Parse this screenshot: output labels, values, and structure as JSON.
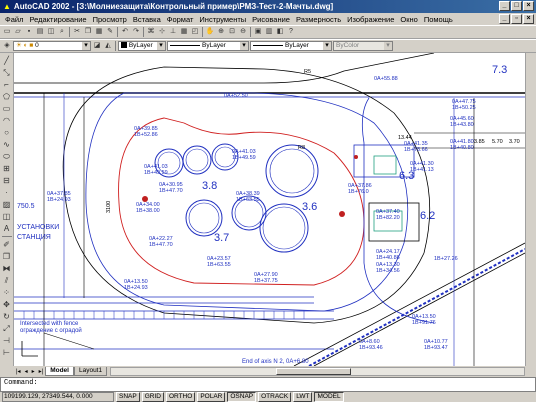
{
  "window": {
    "title": "AutoCAD 2002 - [З:\\Молниезащита\\Контрольный пример\\РМЗ-Тест-2-Мачты.dwg]"
  },
  "menu": [
    "Файл",
    "Редактирование",
    "Просмотр",
    "Вставка",
    "Формат",
    "Инструменты",
    "Рисование",
    "Размерность",
    "Изображение",
    "Окно",
    "Помощь"
  ],
  "toolbar2": {
    "layer": "0",
    "color": "ByLayer",
    "linetype": "ByLayer",
    "lineweight": "ByLayer",
    "plotstyle": "ByColor"
  },
  "tabs": [
    "Model",
    "Layout1"
  ],
  "command": {
    "prompt": "Command:"
  },
  "status": {
    "coords": "109199.129, 27349.544, 0.000",
    "buttons": [
      "SNAP",
      "GRID",
      "ORTHO",
      "POLAR",
      "OSNAP",
      "OTRACK",
      "LWT",
      "MODEL"
    ]
  },
  "drawing": {
    "labels": [
      "0A+52.50",
      "0A+55.88",
      "0A+39.85",
      "1B+52.86",
      "0A+41.03",
      "1B+49.59",
      "0A+41.03",
      "1B+49.59",
      "0A+30.95",
      "1B+47.70",
      "0A+34.00",
      "1B+38.00",
      "0A+38.39",
      "1B+63.55",
      "0A+37.85",
      "1B+24.93",
      "0A+22.27",
      "1B+47.70",
      "0A+23.57",
      "1B+63.55",
      "0A+13.50",
      "1B+24.93",
      "0A+27.90",
      "1B+37.75",
      "0A+37.86",
      "1B+76.0",
      "0A+37.40",
      "1B+82.20",
      "0A+24.17",
      "1B+40.86",
      "0A+13.30",
      "1B+34.56",
      "0A+47.75",
      "1B+50.25",
      "0A+45.60",
      "1B+43.80",
      "0A+41.80",
      "1B+40.80",
      "0A+41.30",
      "1B+41.13",
      "0A+41.35",
      "1B+78.66",
      "0A+13.50",
      "1B+91.76",
      "0A+8.60",
      "1B+93.46",
      "0A+10.77",
      "1B+93.47",
      "1B+27.26",
      "3.8",
      "3.6",
      "3.7",
      "6.3",
      "6.2",
      "7.3",
      "R8",
      "R5",
      "3100",
      "13.44",
      "5.70",
      "3.70",
      "3.85",
      "УСТАНОВКИ",
      "СТАНЦИЯ",
      "750.5",
      "Intersected with fence",
      "ограждение с оградой",
      "End of axis N 2, 0A+6.80"
    ]
  }
}
